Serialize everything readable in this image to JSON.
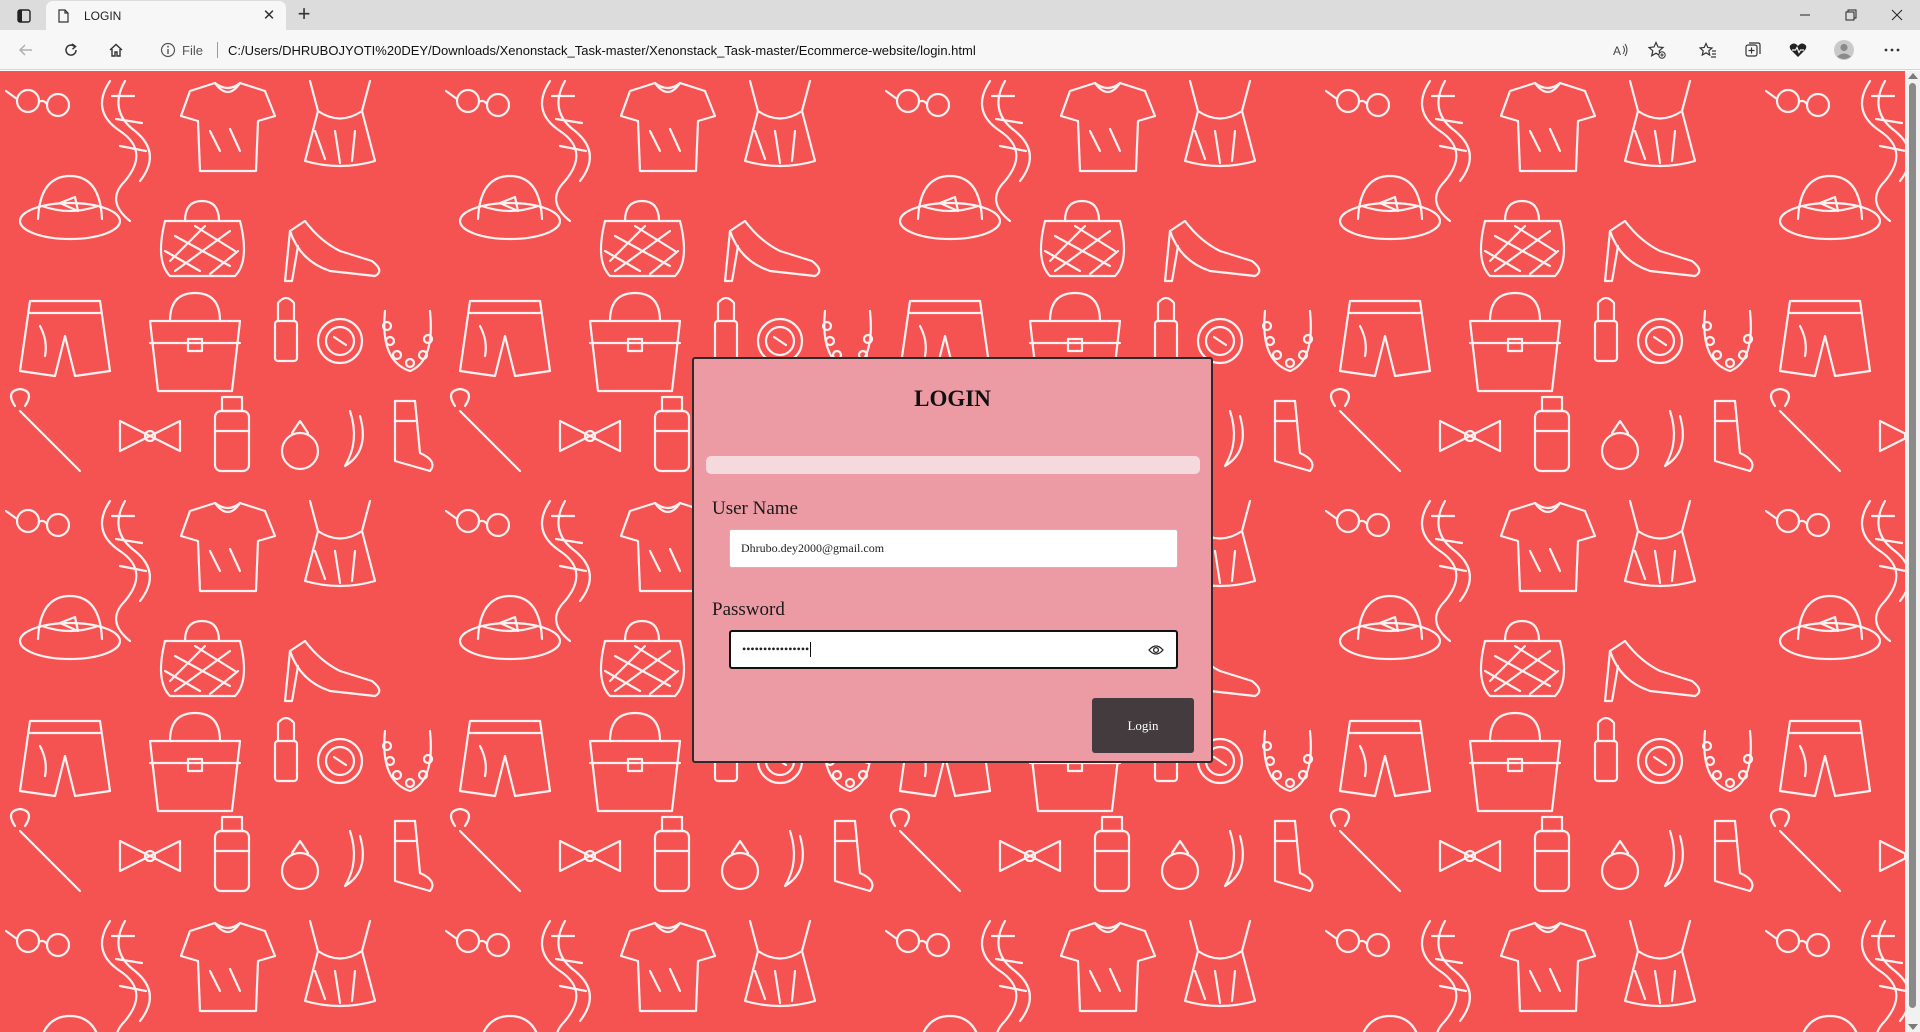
{
  "browser": {
    "tab": {
      "title": "LOGIN"
    },
    "address": {
      "scheme_label": "File",
      "url": "C:/Users/DHRUBOJYOTI%20DEY/Downloads/Xenonstack_Task-master/Xenonstack_Task-master/Ecommerce-website/login.html"
    },
    "icons": [
      "tab-actions-icon",
      "page-icon",
      "close-icon",
      "new-tab-icon",
      "back-icon",
      "refresh-icon",
      "home-icon",
      "info-icon",
      "read-aloud-icon",
      "add-favorite-icon",
      "favorites-icon",
      "collections-icon",
      "browser-essentials-icon",
      "profile-icon",
      "more-icon",
      "minimize-icon",
      "restore-icon",
      "window-close-icon"
    ]
  },
  "login": {
    "title": "LOGIN",
    "username_label": "User Name",
    "username_value": "Dhrubo.dey2000@gmail.com",
    "password_label": "Password",
    "password_value": "••••••••••••••••",
    "button_label": "Login"
  },
  "colors": {
    "page_background": "#f55252",
    "card_background": "#ec9ba4",
    "status_bar": "#f5d9dc",
    "button": "#433b3d"
  }
}
